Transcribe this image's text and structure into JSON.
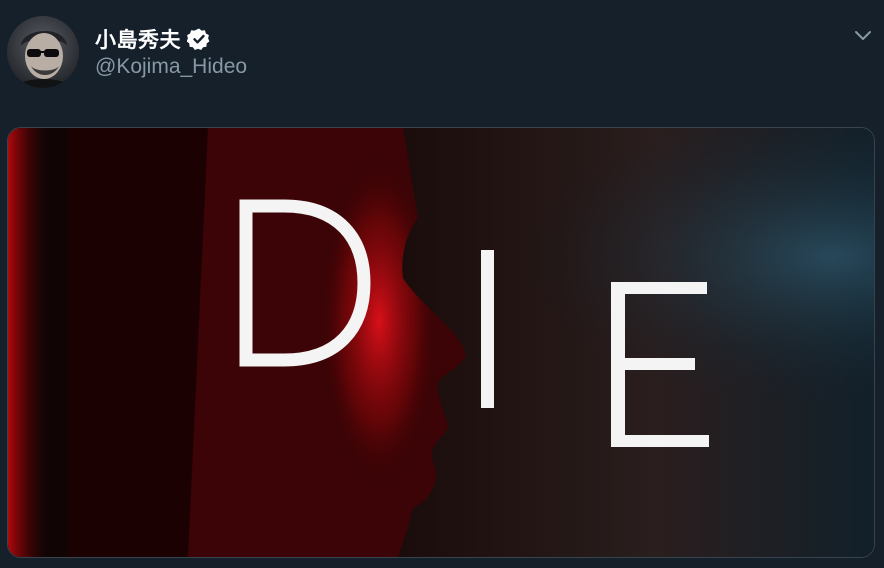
{
  "tweet": {
    "display_name": "小島秀夫",
    "handle": "@Kojima_Hideo",
    "verified": true,
    "icons": {
      "verified": "verified-badge-icon",
      "menu": "chevron-down-icon"
    },
    "media": {
      "text_letters": [
        "D",
        "I",
        "E"
      ]
    }
  },
  "colors": {
    "background": "#15202b",
    "secondary_text": "#8899a6",
    "border": "#38444d",
    "red_glow": "#e0101a"
  }
}
